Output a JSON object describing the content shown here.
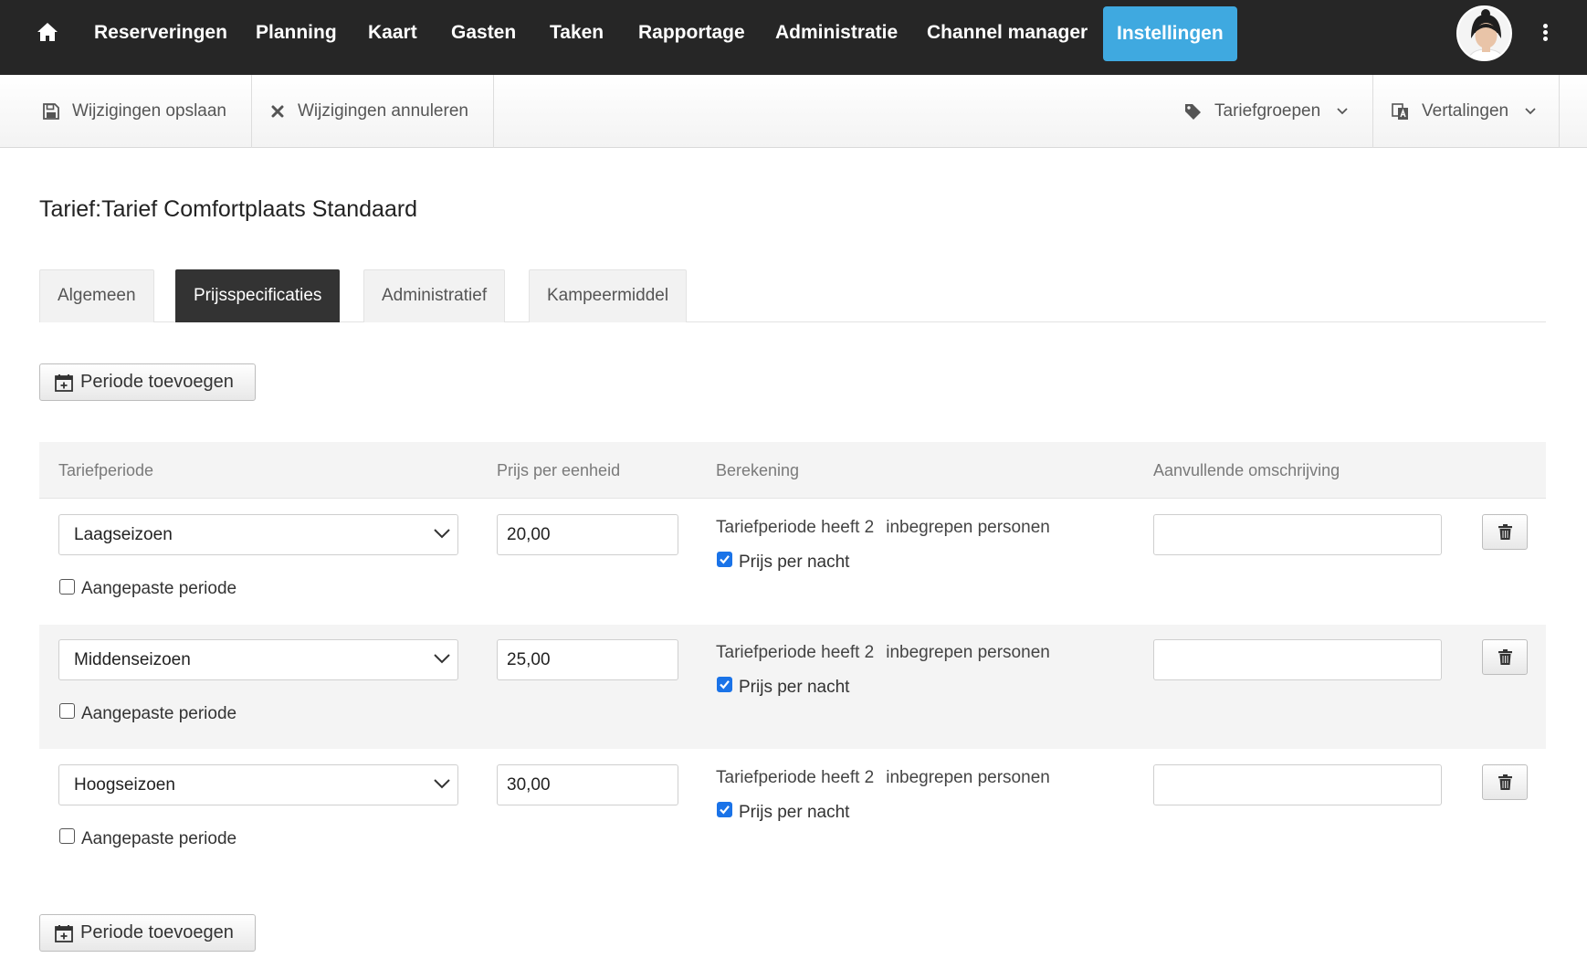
{
  "nav": {
    "home_icon": "home-icon",
    "items": [
      "Reserveringen",
      "Planning",
      "Kaart",
      "Gasten",
      "Taken",
      "Rapportage",
      "Administratie",
      "Channel manager",
      "Instellingen"
    ],
    "active": "Instellingen",
    "active_color": "#3fa9e0",
    "menu_icon": "kebab-menu-icon"
  },
  "toolbar": {
    "save_label": "Wijzigingen opslaan",
    "cancel_label": "Wijzigingen annuleren",
    "tariefgroepen_label": "Tariefgroepen",
    "vertalingen_label": "Vertalingen"
  },
  "page": {
    "title": "Tarief:Tarief Comfortplaats Standaard"
  },
  "tabs": [
    "Algemeen",
    "Prijsspecificaties",
    "Administratief",
    "Kampeermiddel"
  ],
  "active_tab": "Prijsspecificaties",
  "add_period_label": "Periode toevoegen",
  "table": {
    "headers": [
      "Tariefperiode",
      "Prijs per eenheid",
      "Berekening",
      "Aanvullende omschrijving"
    ],
    "rows": [
      {
        "period": "Laagseizoen",
        "custom_label": "Aangepaste periode",
        "custom_checked": false,
        "price": "20,00",
        "calc_text": "Tariefperiode heeft 2",
        "calc_suffix": "inbegrepen personen",
        "per_night_label": "Prijs per nacht",
        "per_night_checked": true,
        "description": ""
      },
      {
        "period": "Middenseizoen",
        "custom_label": "Aangepaste periode",
        "custom_checked": false,
        "price": "25,00",
        "calc_text": "Tariefperiode heeft 2",
        "calc_suffix": "inbegrepen personen",
        "per_night_label": "Prijs per nacht",
        "per_night_checked": true,
        "description": ""
      },
      {
        "period": "Hoogseizoen",
        "custom_label": "Aangepaste periode",
        "custom_checked": false,
        "price": "30,00",
        "calc_text": "Tariefperiode heeft 2",
        "calc_suffix": "inbegrepen personen",
        "per_night_label": "Prijs per nacht",
        "per_night_checked": true,
        "description": ""
      }
    ]
  }
}
